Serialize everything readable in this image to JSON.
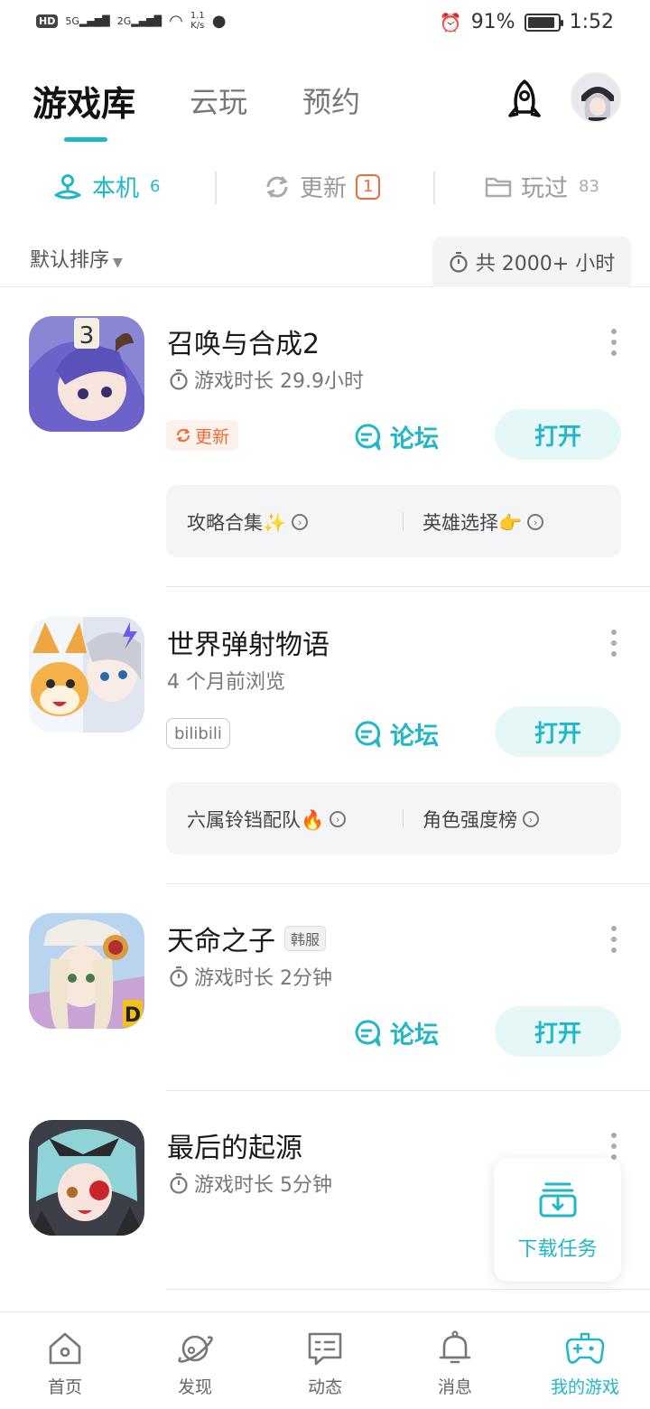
{
  "status_bar": {
    "hd": "HD",
    "sim1": "5G",
    "sim2": "2G",
    "net_speed_value": "1.1",
    "net_speed_unit": "K/s",
    "battery": "91%",
    "battery_level": 0.91,
    "time": "1:52"
  },
  "header": {
    "tabs": [
      {
        "label": "游戏库",
        "active": true
      },
      {
        "label": "云玩",
        "active": false
      },
      {
        "label": "预约",
        "active": false
      }
    ]
  },
  "subtabs": {
    "local": {
      "label": "本机",
      "count": "6"
    },
    "update": {
      "label": "更新",
      "count": "1"
    },
    "played": {
      "label": "玩过",
      "count": "83"
    }
  },
  "sort": {
    "label": "默认排序",
    "total": "共 2000+ 小时"
  },
  "games": [
    {
      "title": "召唤与合成2",
      "subtitle": "游戏时长 29.9小时",
      "tag": "更新",
      "forum": "论坛",
      "open": "打开",
      "links": [
        "攻略合集✨",
        "英雄选择👉"
      ]
    },
    {
      "title": "世界弹射物语",
      "subtitle": "4 个月前浏览",
      "tag": "bilibili",
      "forum": "论坛",
      "open": "打开",
      "links": [
        "六属铃铛配队🔥",
        "角色强度榜"
      ]
    },
    {
      "title": "天命之子",
      "region_tag": "韩服",
      "subtitle": "游戏时长 2分钟",
      "forum": "论坛",
      "open": "打开"
    },
    {
      "title": "最后的起源",
      "subtitle": "游戏时长 5分钟"
    }
  ],
  "download": {
    "label": "下载任务"
  },
  "bottom_nav": [
    {
      "label": "首页",
      "icon": "home-icon"
    },
    {
      "label": "发现",
      "icon": "planet-icon"
    },
    {
      "label": "动态",
      "icon": "message-icon"
    },
    {
      "label": "消息",
      "icon": "bell-icon"
    },
    {
      "label": "我的游戏",
      "icon": "gamepad-icon",
      "active": true
    }
  ],
  "colors": {
    "accent": "#22b7c6",
    "update_orange": "#ef6b3b"
  }
}
